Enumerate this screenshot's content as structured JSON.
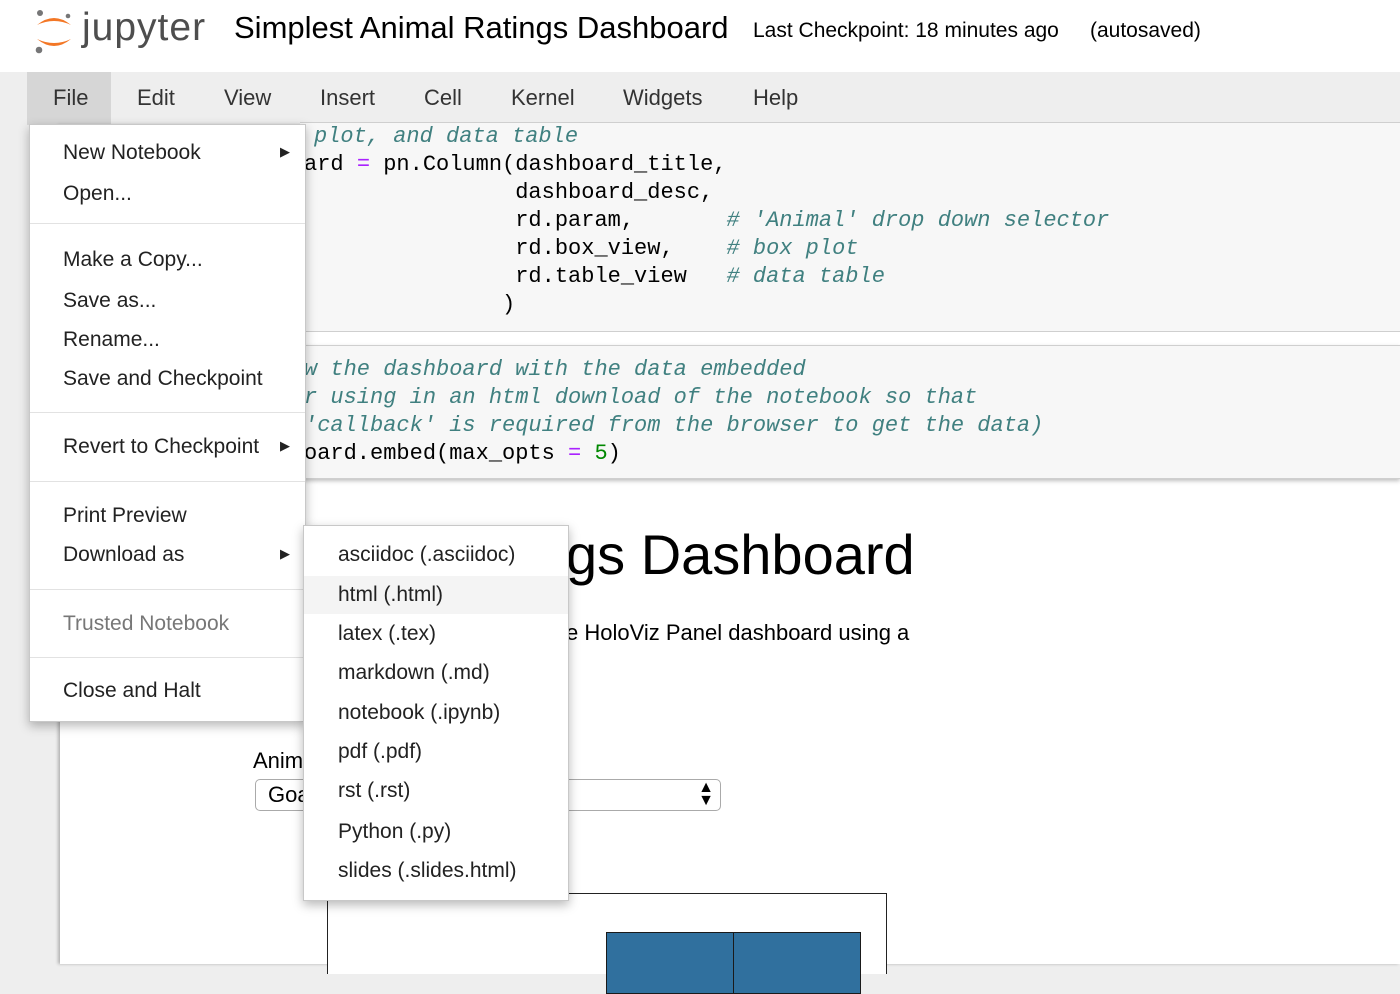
{
  "header": {
    "logo_text": "jupyter",
    "notebook_title": "Simplest Animal Ratings Dashboard",
    "checkpoint": "Last Checkpoint: 18 minutes ago",
    "save_status": "(autosaved)"
  },
  "menubar": {
    "items": [
      "File",
      "Edit",
      "View",
      "Insert",
      "Cell",
      "Kernel",
      "Widgets",
      "Help"
    ],
    "active": "File"
  },
  "code_cell_1": {
    "lines": [
      {
        "code": "",
        "comment": "plot, and data table"
      },
      {
        "code": "ard = pn.Column(dashboard_title,",
        "comment": ""
      },
      {
        "code": "                dashboard_desc,",
        "comment": ""
      },
      {
        "code": "                rd.param,",
        "comment": "# 'Animal' drop down selector"
      },
      {
        "code": "                rd.box_view,",
        "comment": "# box plot"
      },
      {
        "code": "                rd.table_view",
        "comment": "# data table"
      },
      {
        "code": "               )",
        "comment": ""
      }
    ]
  },
  "code_cell_2": {
    "lines": [
      {
        "code": "",
        "comment": "w the dashboard with the data embedded"
      },
      {
        "code": "",
        "comment": "r using in an html download of the notebook so that"
      },
      {
        "code": "",
        "comment": "'callback' is required from the browser to get the data)"
      },
      {
        "code": "oard.embed(max_opts = 5)",
        "comment": ""
      }
    ]
  },
  "output": {
    "heading": "gs Dashboard",
    "description": "e HoloViz Panel dashboard using a",
    "animal_label": "Anim",
    "select_value": "Goa"
  },
  "file_menu": {
    "items": [
      {
        "label": "New Notebook",
        "submenu": true,
        "disabled": false
      },
      {
        "label": "Open...",
        "submenu": false,
        "disabled": false
      },
      {
        "label": "Make a Copy...",
        "submenu": false,
        "disabled": false
      },
      {
        "label": "Save as...",
        "submenu": false,
        "disabled": false
      },
      {
        "label": "Rename...",
        "submenu": false,
        "disabled": false
      },
      {
        "label": "Save and Checkpoint",
        "submenu": false,
        "disabled": false
      },
      {
        "label": "Revert to Checkpoint",
        "submenu": true,
        "disabled": false
      },
      {
        "label": "Print Preview",
        "submenu": false,
        "disabled": false
      },
      {
        "label": "Download as",
        "submenu": true,
        "disabled": false
      },
      {
        "label": "Trusted Notebook",
        "submenu": false,
        "disabled": true
      },
      {
        "label": "Close and Halt",
        "submenu": false,
        "disabled": false
      }
    ]
  },
  "download_menu": {
    "items": [
      "asciidoc (.asciidoc)",
      "html (.html)",
      "latex (.tex)",
      "markdown (.md)",
      "notebook (.ipynb)",
      "pdf (.pdf)",
      "rst (.rst)",
      "Python (.py)",
      "slides (.slides.html)"
    ],
    "highlighted": "html (.html)"
  },
  "colors": {
    "logo_orange": "#f37726",
    "logo_gray": "#767677",
    "comment": "#408080",
    "operator": "#aa22ff",
    "number": "#008800",
    "bar": "#30709e"
  }
}
